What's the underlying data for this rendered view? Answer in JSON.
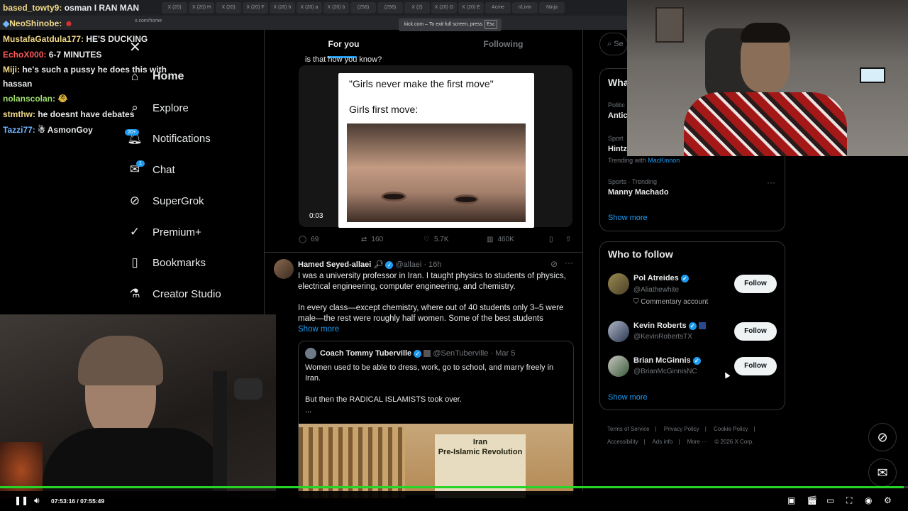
{
  "browser": {
    "tabs": [
      "X (20)",
      "X (20) H",
      "X (20)",
      "X (20) F",
      "X (20) h",
      "X (20) a",
      "X (20) b",
      "(256)",
      "(256)",
      "X (2) ",
      "X (20) G",
      "X (20) E",
      "Acme",
      "r/Livin",
      "Ninja"
    ],
    "url": "x.com/home",
    "fullscreen_hint": "kick.com – To exit full screen, press",
    "fullscreen_key": "Esc"
  },
  "chat": [
    {
      "name": "based_towty9:",
      "text": "osman I RAN MAN",
      "name_color": "#f2d98a"
    },
    {
      "name": "NeoShinobe:",
      "text": "",
      "name_color": "#f2d98a"
    },
    {
      "name": "MustafaGatdula177:",
      "text": "HE'S DUCKING",
      "name_color": "#f2d98a"
    },
    {
      "name": "EchoX000:",
      "text": "6-7 MINUTES",
      "name_color": "#ff5a5a"
    },
    {
      "name": "Miji:",
      "text": "he's such a pussy he does this with hassan",
      "name_color": "#f2d98a"
    },
    {
      "name": "nolanscolan:",
      "text": "",
      "name_color": "#9fdf6f"
    },
    {
      "name": "stmthw:",
      "text": "he doesnt have debates",
      "name_color": "#f2d98a"
    },
    {
      "name": "Tazzi77:",
      "text": "AsmonGoy",
      "name_color": "#6fb6ff"
    }
  ],
  "nav": {
    "items": [
      {
        "label": "Home",
        "icon": "home-icon"
      },
      {
        "label": "Explore",
        "icon": "search-icon"
      },
      {
        "label": "Notifications",
        "icon": "bell-icon",
        "badge": "20+"
      },
      {
        "label": "Chat",
        "icon": "mail-icon",
        "badge": "1"
      },
      {
        "label": "SuperGrok",
        "icon": "grok-icon"
      },
      {
        "label": "Premium+",
        "icon": "verified-icon"
      },
      {
        "label": "Bookmarks",
        "icon": "bookmark-icon"
      },
      {
        "label": "Creator Studio",
        "icon": "flask-icon"
      }
    ]
  },
  "feed": {
    "tabs": [
      "For you",
      "Following"
    ],
    "prev_tweet_tail": "is that how you know?",
    "meme": {
      "line1": "\"Girls never make the first move\"",
      "line2": "Girls first move:",
      "video_time": "0:03"
    },
    "prev_actions": {
      "replies": "69",
      "reposts": "160",
      "likes": "5.7K",
      "views": "460K"
    },
    "tweet": {
      "name": "Hamed Seyed-allaei",
      "handle": "@allaei",
      "time": "16h",
      "body1": "I was a university professor in Iran. I taught physics to students of physics, electrical engineering, computer engineering, and chemistry.",
      "body2": "In every class—except chemistry, where out of 40 students only 3–5 were male—the rest were roughly half women. Some of the best students",
      "show_more": "Show more",
      "quote": {
        "name": "Coach Tommy Tuberville",
        "handle": "@SenTuberville",
        "date": "Mar 5",
        "line1": "Women used to be able to dress, work, go to school, and marry freely in Iran.",
        "line2": "But then the RADICAL ISLAMISTS took over.",
        "line3": "...",
        "sign_line1": "Iran",
        "sign_line2": "Pre-Islamic Revolution"
      }
    }
  },
  "right": {
    "search_placeholder": "Se",
    "trends_header": "Wha",
    "trends": [
      {
        "cat": "Politic",
        "name": "Antic"
      },
      {
        "cat": "Sport",
        "name": "Hintz",
        "sub": "Trending with",
        "sub_link": "MacKinnon"
      },
      {
        "cat": "Sports · Trending",
        "name": "Manny Machado"
      }
    ],
    "trends_show_more": "Show more",
    "who_header": "Who to follow",
    "who": [
      {
        "name": "Pol Atreides",
        "handle": "@Aliathewhite",
        "extra": "Commentary account",
        "btn": "Follow"
      },
      {
        "name": "Kevin Roberts",
        "handle": "@KevinRobertsTX",
        "extra": "",
        "btn": "Follow"
      },
      {
        "name": "Brian McGinnis",
        "handle": "@BrianMcGinnisNC",
        "extra": "",
        "btn": "Follow"
      }
    ],
    "who_show_more": "Show more",
    "footer": [
      "Terms of Service",
      "Privacy Policy",
      "Cookie Policy",
      "Accessibility",
      "Ads info",
      "More ···",
      "© 2026 X Corp."
    ]
  },
  "player": {
    "time": "07:53:16 / 07:55:49",
    "progress": 0.995
  }
}
